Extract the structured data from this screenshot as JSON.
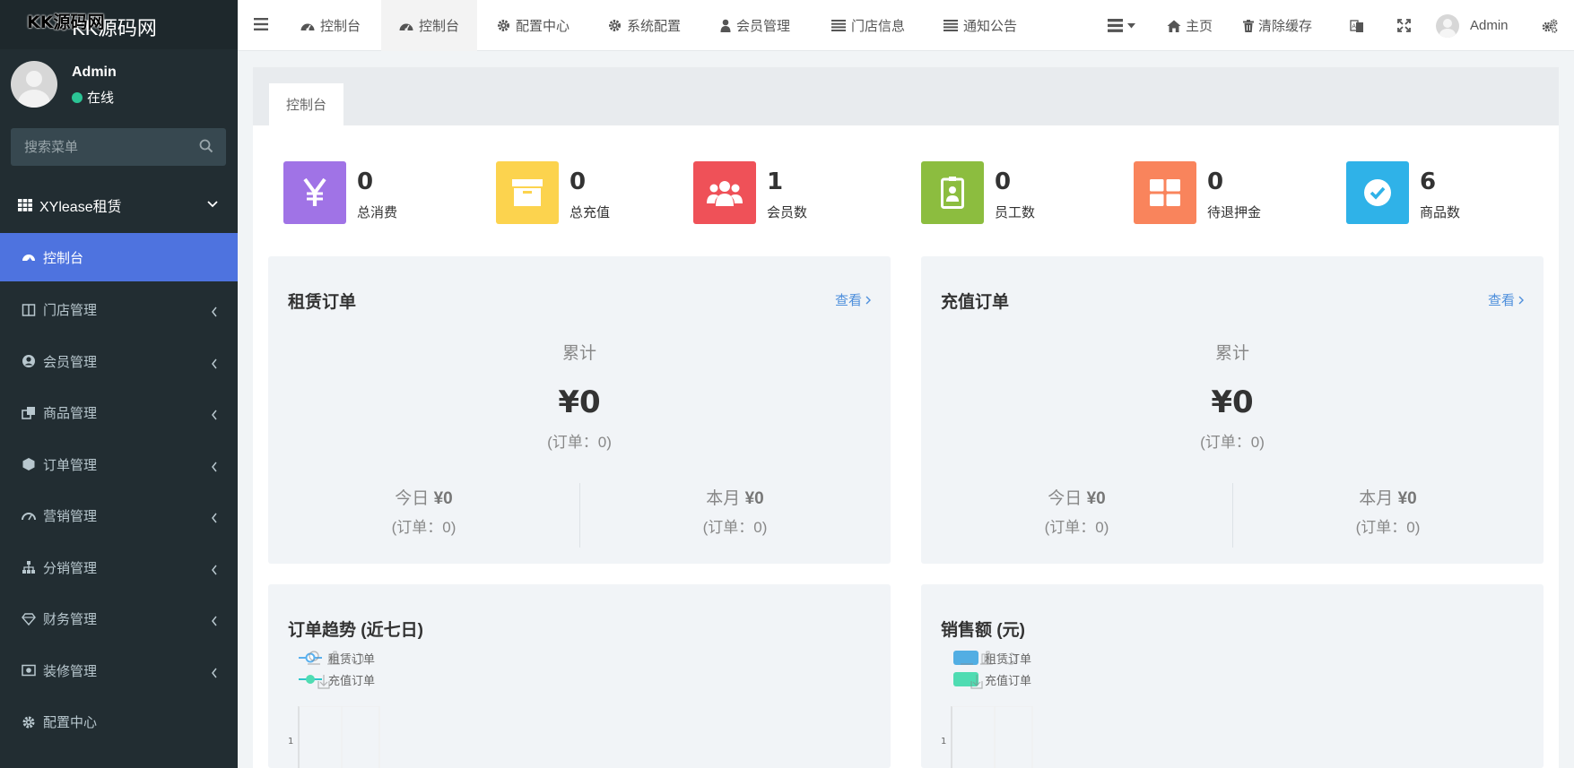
{
  "sidebar": {
    "brand_logo": "KK源码网",
    "brand_watermark": "KK源码网",
    "user": {
      "name": "Admin",
      "status": "在线"
    },
    "search_placeholder": "搜索菜单",
    "group_label": "XYlease租赁",
    "items": [
      {
        "label": "控制台",
        "icon": "dashboard-icon",
        "active": true
      },
      {
        "label": "门店管理",
        "icon": "columns-icon"
      },
      {
        "label": "会员管理",
        "icon": "user-circle-icon"
      },
      {
        "label": "商品管理",
        "icon": "clone-icon"
      },
      {
        "label": "订单管理",
        "icon": "cube-icon"
      },
      {
        "label": "营销管理",
        "icon": "tachometer-icon"
      },
      {
        "label": "分销管理",
        "icon": "sitemap-icon"
      },
      {
        "label": "财务管理",
        "icon": "diamond-icon"
      },
      {
        "label": "装修管理",
        "icon": "image-icon"
      },
      {
        "label": "配置中心",
        "icon": "gear-icon"
      }
    ]
  },
  "topbar": {
    "tabs": [
      {
        "label": "控制台",
        "icon": "dashboard-icon"
      },
      {
        "label": "控制台",
        "icon": "dashboard-icon",
        "active": true
      },
      {
        "label": "配置中心",
        "icon": "gear-icon"
      },
      {
        "label": "系统配置",
        "icon": "gear-icon"
      },
      {
        "label": "会员管理",
        "icon": "user-icon"
      },
      {
        "label": "门店信息",
        "icon": "list-icon"
      },
      {
        "label": "通知公告",
        "icon": "list-icon"
      }
    ],
    "home_label": "主页",
    "clear_cache_label": "清除缓存",
    "user_name": "Admin"
  },
  "content": {
    "tab_label": "控制台",
    "stats": [
      {
        "value": "0",
        "label": "总消费",
        "color": "#a073e6",
        "icon": "yen-icon"
      },
      {
        "value": "0",
        "label": "总充值",
        "color": "#fcd34e",
        "icon": "archive-icon"
      },
      {
        "value": "1",
        "label": "会员数",
        "color": "#ef5158",
        "icon": "users-icon"
      },
      {
        "value": "0",
        "label": "员工数",
        "color": "#8cbd3f",
        "icon": "id-badge-icon"
      },
      {
        "value": "0",
        "label": "待退押金",
        "color": "#f9845c",
        "icon": "th-large-icon"
      },
      {
        "value": "6",
        "label": "商品数",
        "color": "#2fb2e8",
        "icon": "check-circle-icon"
      }
    ],
    "rent_card": {
      "title": "租赁订单",
      "link": "查看",
      "total_label": "累计",
      "total_amount": "¥0",
      "total_orders": "(订单：0)",
      "today_label": "今日",
      "today_amount": "¥0",
      "today_orders": "(订单：0)",
      "month_label": "本月",
      "month_amount": "¥0",
      "month_orders": "(订单：0)"
    },
    "recharge_card": {
      "title": "充值订单",
      "link": "查看",
      "total_label": "累计",
      "total_amount": "¥0",
      "total_orders": "(订单：0)",
      "today_label": "今日",
      "today_amount": "¥0",
      "today_orders": "(订单：0)",
      "month_label": "本月",
      "month_amount": "¥0",
      "month_orders": "(订单：0)"
    },
    "trend_chart": {
      "title": "订单趋势 (近七日)",
      "legend": [
        "租赁订单",
        "充值订单"
      ],
      "colors": [
        "#5ab1ef",
        "#2ec7c9"
      ],
      "y_tick": "1"
    },
    "sales_chart": {
      "title": "销售额 (元)",
      "legend": [
        "租赁订单",
        "充值订单"
      ],
      "colors": [
        "#52aee3",
        "#4fdcb2"
      ],
      "y_tick": "1"
    }
  }
}
